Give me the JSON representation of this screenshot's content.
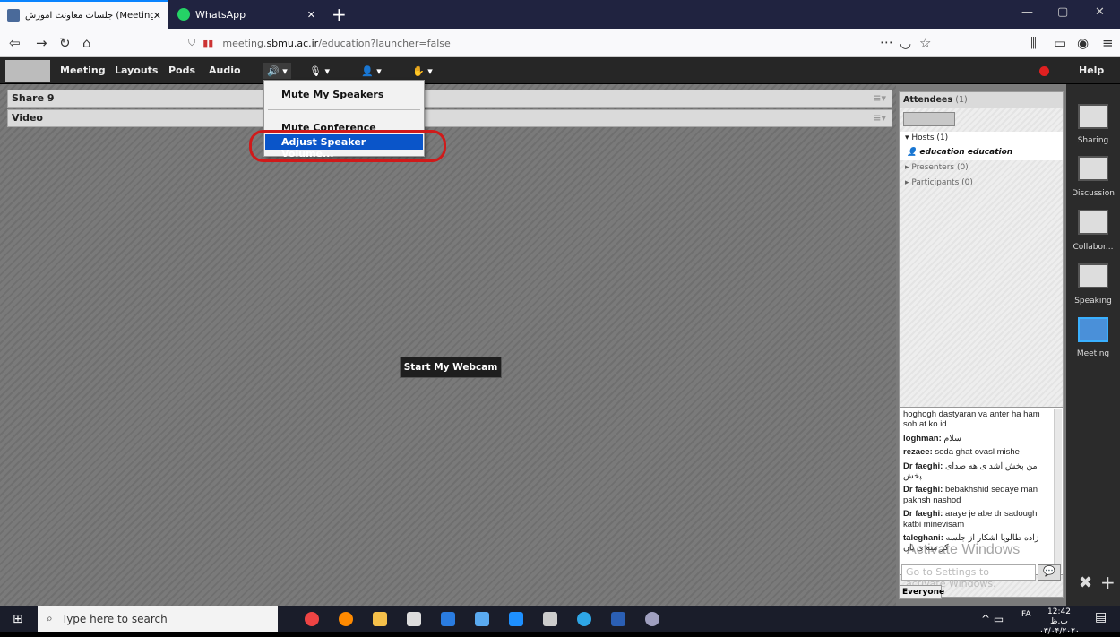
{
  "browser": {
    "tabs": [
      {
        "label": "جلسات معاونت آموزش (Meeting)",
        "close": "✕"
      },
      {
        "label": "WhatsApp",
        "close": "✕"
      }
    ],
    "new_tab": "+",
    "url_prefix": "meeting.",
    "url_domain": "sbmu.ac.ir",
    "url_path": "/education?launcher=false",
    "window_controls": [
      "—",
      "▢",
      "✕"
    ]
  },
  "appbar": {
    "menus": [
      "Meeting",
      "Layouts",
      "Pods",
      "Audio"
    ],
    "help": "Help"
  },
  "dropdown": {
    "items": [
      "Mute My Speakers",
      "Mute Conference Audio Only",
      "Adjust Speaker Volume..."
    ]
  },
  "pods": {
    "share_title": "Share 9",
    "video_title": "Video",
    "webcam_button": "Start My Webcam"
  },
  "attendees": {
    "title": "Attendees",
    "count": "(1)",
    "hosts": "Hosts (1)",
    "host_name": "education education",
    "presenters": "Presenters (0)",
    "participants": "Participants (0)"
  },
  "chat": {
    "messages": [
      {
        "name": "",
        "text": "hoghogh dastyaran va anter  ha ham soh at ko id"
      },
      {
        "name": "loghman:",
        "text": "سلام"
      },
      {
        "name": "rezaee:",
        "text": "seda ghat ovasl mishe"
      },
      {
        "name": "Dr faeghi:",
        "text": "من پخش اشد ی هه صدای پخش"
      },
      {
        "name": "Dr faeghi:",
        "text": "bebakhshid sedaye man pakhsh nashod"
      },
      {
        "name": "Dr faeghi:",
        "text": "araye je abe dr sadoughi katbi minevisam"
      },
      {
        "name": "taleghani:",
        "text": "زاده طالوپا اشکار از جلسه کر میه ی یاں"
      }
    ],
    "input_placeholder": "Go to Settings to activate Windows.",
    "recipient": "Everyone"
  },
  "watermark": "Activate Windows",
  "layouts": [
    "Sharing",
    "Discussion",
    "Collabor...",
    "Speaking",
    "Meeting"
  ],
  "taskbar": {
    "search_placeholder": "Type here to search",
    "time": "12:42 ب.ظ",
    "date": "۰۳/۰۴/۲۰۲۰",
    "lang": "FA"
  }
}
